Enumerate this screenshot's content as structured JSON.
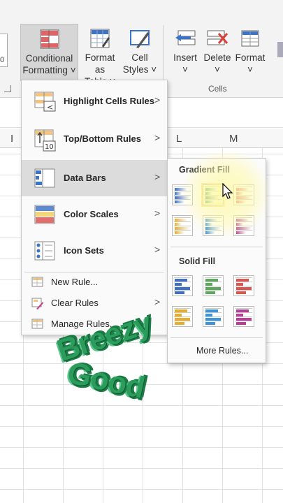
{
  "ribbon": {
    "buttons": [
      {
        "label1": "Conditional",
        "label2": "Formatting ˅"
      },
      {
        "label1": "Format as",
        "label2": "Table ˅"
      },
      {
        "label1": "Cell",
        "label2": "Styles ˅"
      },
      {
        "label1": "Insert",
        "label2": "˅"
      },
      {
        "label1": "Delete",
        "label2": "˅"
      },
      {
        "label1": "Format",
        "label2": "˅"
      }
    ],
    "cells_group_label": "Cells",
    "left_stub_text": "0"
  },
  "sheet": {
    "columns": [
      "I",
      "L",
      "M"
    ]
  },
  "menu": {
    "items": [
      {
        "label": "Highlight Cells Rules",
        "icon": "highlight-cells-icon"
      },
      {
        "label": "Top/Bottom Rules",
        "icon": "top-bottom-icon"
      },
      {
        "label": "Data Bars",
        "icon": "data-bars-icon"
      },
      {
        "label": "Color Scales",
        "icon": "color-scales-icon"
      },
      {
        "label": "Icon Sets",
        "icon": "icon-sets-icon"
      }
    ],
    "secondary": [
      {
        "label": "New Rule...",
        "icon": "new-rule-icon"
      },
      {
        "label": "Clear Rules",
        "icon": "clear-rules-icon"
      },
      {
        "label": "Manage Rules...",
        "icon": "manage-rules-icon"
      }
    ],
    "chevron": ">"
  },
  "submenu": {
    "gradient_title": "Gradient Fill",
    "solid_title": "Solid Fill",
    "more_rules": "More Rules...",
    "colors": [
      "#3f6fc4",
      "#5aaa5a",
      "#e0534d",
      "#e9ad2a",
      "#3b95d8",
      "#b83c9a"
    ]
  },
  "overlay": {
    "line1": "Breezy",
    "line2": "Good"
  }
}
